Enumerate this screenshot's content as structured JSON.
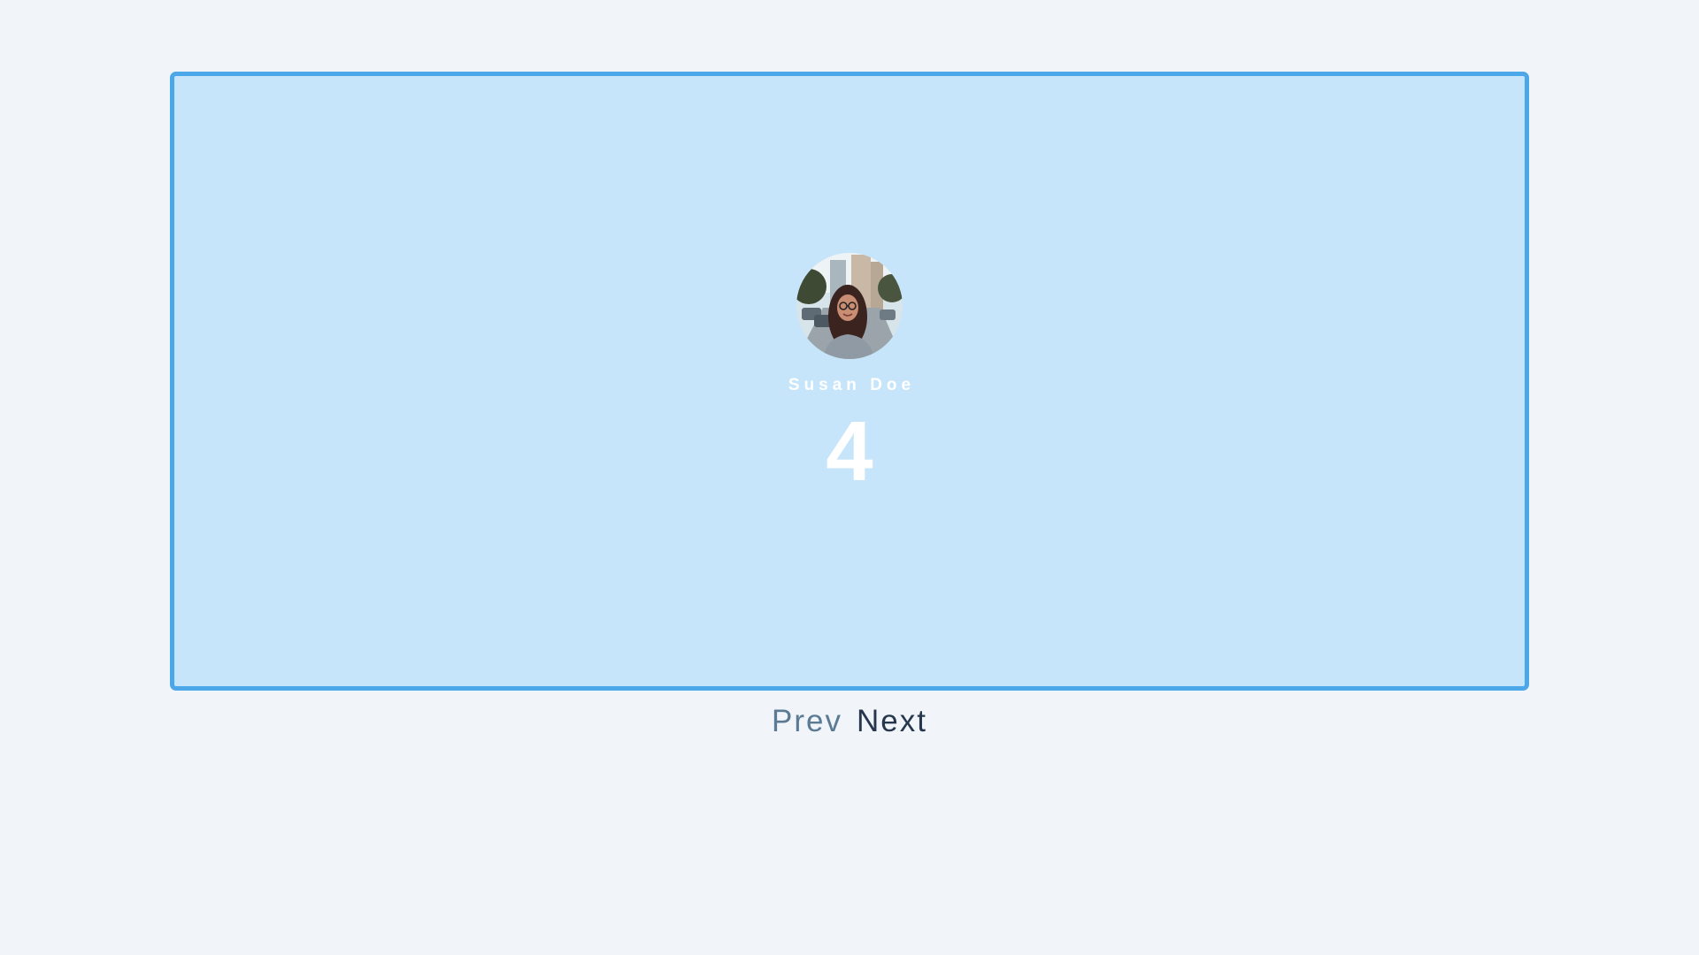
{
  "profile": {
    "name": "Susan Doe",
    "count": "4",
    "avatar_icon": "user-photo"
  },
  "pager": {
    "prev_label": "Prev",
    "next_label": "Next"
  },
  "colors": {
    "page_background": "#f1f5f9",
    "card_background": "#c6e5fa",
    "card_border": "#4ba7e8",
    "prev_text": "#5b7a94",
    "next_text": "#26374d",
    "profile_text": "#ffffff"
  }
}
